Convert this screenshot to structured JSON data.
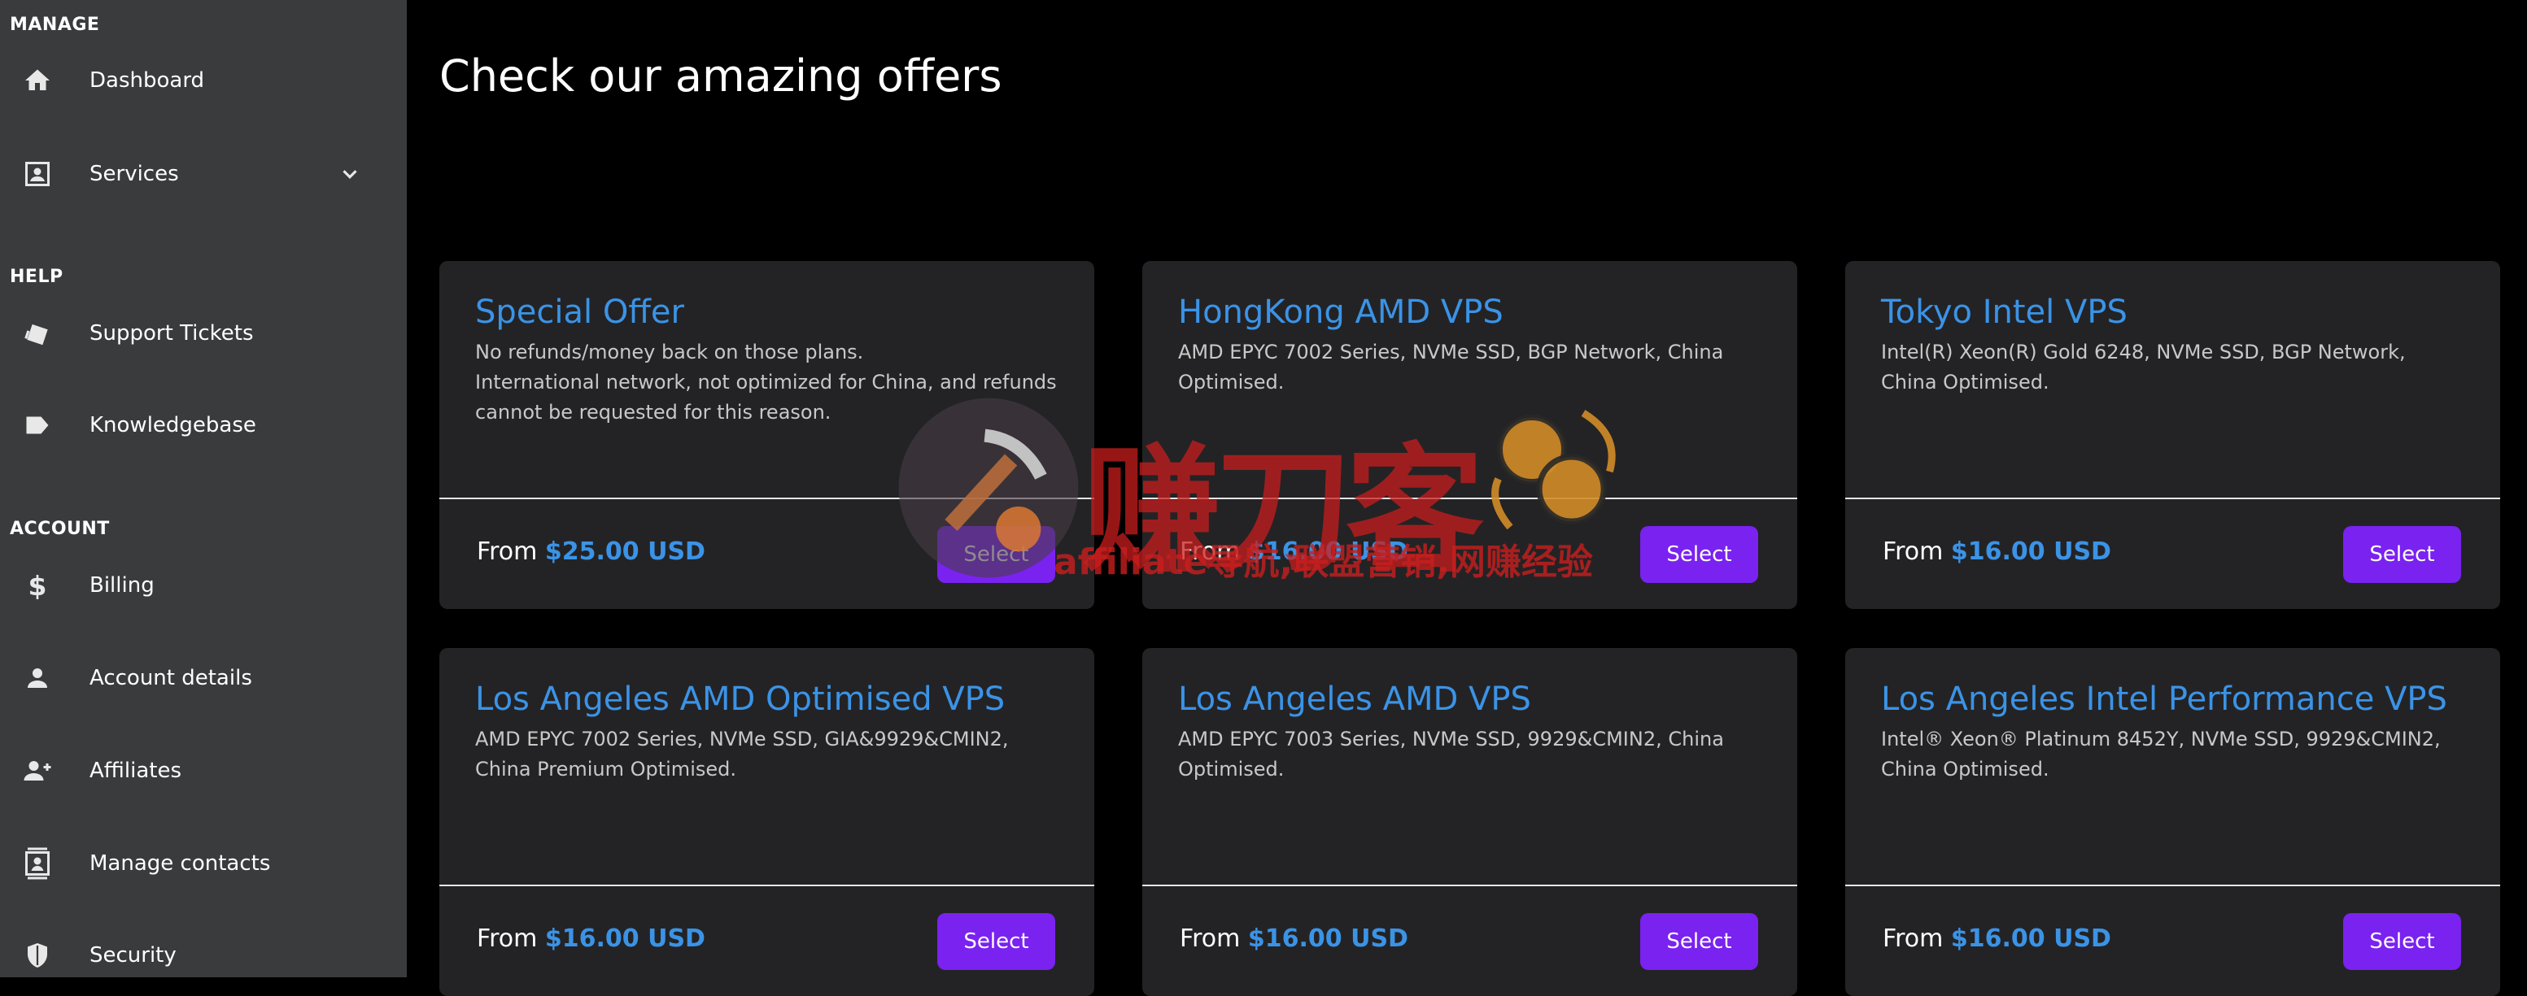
{
  "sidebar": {
    "sections": [
      {
        "label": "MANAGE"
      },
      {
        "label": "HELP"
      },
      {
        "label": "ACCOUNT"
      }
    ],
    "items": [
      {
        "label": "Dashboard",
        "icon": "home-icon"
      },
      {
        "label": "Services",
        "icon": "services-icon"
      },
      {
        "label": "Support Tickets",
        "icon": "ticket-icon"
      },
      {
        "label": "Knowledgebase",
        "icon": "label-icon"
      },
      {
        "label": "Billing",
        "icon": "dollar-icon"
      },
      {
        "label": "Account details",
        "icon": "person-icon"
      },
      {
        "label": "Affiliates",
        "icon": "person-add-icon"
      },
      {
        "label": "Manage contacts",
        "icon": "contacts-icon"
      },
      {
        "label": "Security",
        "icon": "shield-icon"
      }
    ]
  },
  "main": {
    "title": "Check our amazing offers",
    "price_prefix": "From",
    "select_label": "Select",
    "cards": [
      {
        "title": "Special Offer",
        "desc": "No refunds/money back on those plans.\nInternational network, not optimized for China, and refunds cannot be requested for this reason.",
        "price": "$25.00 USD"
      },
      {
        "title": "HongKong AMD VPS",
        "desc": "AMD EPYC 7002 Series, NVMe SSD, BGP Network, China Optimised.",
        "price": "$16.00 USD"
      },
      {
        "title": "Tokyo Intel VPS",
        "desc": "Intel(R) Xeon(R) Gold 6248, NVMe SSD, BGP Network, China Optimised.",
        "price": "$16.00 USD"
      },
      {
        "title": "Los Angeles AMD Optimised VPS",
        "desc": "AMD EPYC 7002 Series, NVMe SSD, GIA&9929&CMIN2, China Premium Optimised.",
        "price": "$16.00 USD"
      },
      {
        "title": "Los Angeles AMD VPS",
        "desc": "AMD EPYC 7003 Series, NVMe SSD, 9929&CMIN2, China Optimised.",
        "price": "$16.00 USD"
      },
      {
        "title": "Los Angeles Intel Performance VPS",
        "desc": "Intel® Xeon® Platinum 8452Y, NVMe SSD, 9929&CMIN2, China Optimised.",
        "price": "$16.00 USD"
      }
    ]
  },
  "watermark": {
    "cn_text": "赚刀客",
    "en_text": "affiliate导航,联盟营销,网赚经验"
  },
  "colors": {
    "sidebar_bg": "#3a3b3d",
    "card_bg": "#232325",
    "accent_blue": "#3b93e6",
    "button_purple": "#7a22f0"
  }
}
